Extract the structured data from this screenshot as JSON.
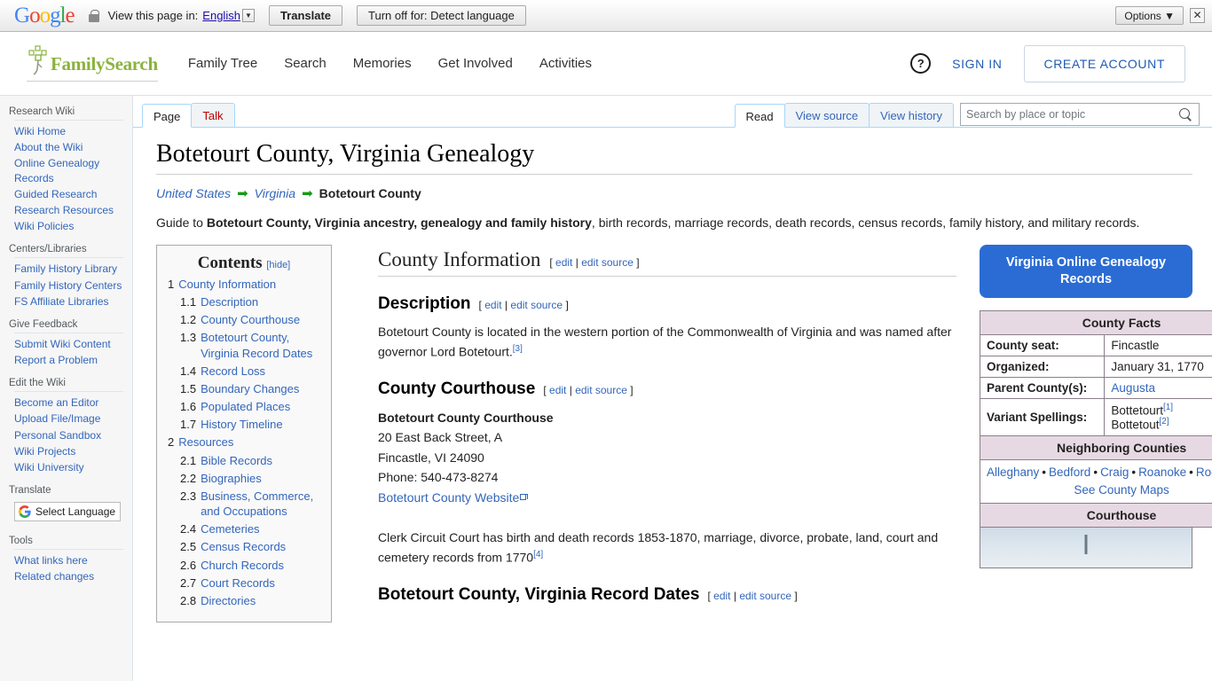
{
  "translate_bar": {
    "logo": "Google",
    "lock_icon": "lock-icon",
    "view_label": "View this page in:",
    "language": "English",
    "translate_button": "Translate",
    "turn_off_button": "Turn off for: Detect language",
    "options_button": "Options",
    "close_icon": "✕"
  },
  "header": {
    "brand": "FamilySearch",
    "nav": [
      {
        "label": "Family Tree"
      },
      {
        "label": "Search"
      },
      {
        "label": "Memories"
      },
      {
        "label": "Get Involved"
      },
      {
        "label": "Activities"
      }
    ],
    "help_icon": "?",
    "sign_in": "SIGN IN",
    "create_account": "CREATE ACCOUNT"
  },
  "sidebar": {
    "groups": [
      {
        "title": "Research Wiki",
        "items": [
          "Wiki Home",
          "About the Wiki",
          "Online Genealogy Records",
          "Guided Research",
          "Research Resources",
          "Wiki Policies"
        ]
      },
      {
        "title": "Centers/Libraries",
        "items": [
          "Family History Library",
          "Family History Centers",
          "FS Affiliate Libraries"
        ]
      },
      {
        "title": "Give Feedback",
        "items": [
          "Submit Wiki Content",
          "Report a Problem"
        ]
      },
      {
        "title": "Edit the Wiki",
        "items": [
          "Become an Editor",
          "Upload File/Image",
          "Personal Sandbox",
          "Wiki Projects",
          "Wiki University"
        ]
      }
    ],
    "translate_title": "Translate",
    "select_language": "Select Language",
    "tools_title": "Tools",
    "tools_items": [
      "What links here",
      "Related changes"
    ]
  },
  "tabs": {
    "left": [
      {
        "label": "Page",
        "state": "active"
      },
      {
        "label": "Talk",
        "state": "newpage"
      }
    ],
    "right": [
      {
        "label": "Read",
        "state": "active"
      },
      {
        "label": "View source",
        "state": "normal"
      },
      {
        "label": "View history",
        "state": "normal"
      }
    ],
    "search_placeholder": "Search by place or topic",
    "search_value": "",
    "search_icon": "search-icon"
  },
  "article": {
    "title": "Botetourt County, Virginia Genealogy",
    "breadcrumb": [
      {
        "label": "United States",
        "type": "link"
      },
      {
        "label": "Virginia",
        "type": "link"
      },
      {
        "label": "Botetourt County",
        "type": "current"
      }
    ],
    "intro_pre": "Guide to ",
    "intro_bold": "Botetourt County, Virginia ancestry, genealogy and family history",
    "intro_post": ", birth records, marriage records, death records, census records, family history, and military records.",
    "edit_open": "[",
    "edit_label": "edit",
    "edit_pipe": "|",
    "edit_source_label": "edit source",
    "edit_close": "]",
    "sections": {
      "county_information": "County Information",
      "description": "Description",
      "description_text": "Botetourt County is located in the western portion of the Commonwealth of Virginia and was named after governor Lord Botetourt.",
      "description_ref": "[3]",
      "county_courthouse": "County Courthouse",
      "courthouse_name": "Botetourt County Courthouse",
      "courthouse_street": "20 East Back Street, A",
      "courthouse_city": "Fincastle, VI 24090",
      "courthouse_phone": "Phone: 540-473-8274",
      "courthouse_website": "Botetourt County Website",
      "clerk_text": "Clerk Circuit Court has birth and death records 1853-1870, marriage, divorce, probate, land, court and cemetery records from 1770",
      "clerk_ref": "[4]",
      "record_dates": "Botetourt County, Virginia Record Dates"
    }
  },
  "toc": {
    "title": "Contents",
    "hide": "[hide]",
    "entries": [
      {
        "num": "1",
        "label": "County Information",
        "level": 1
      },
      {
        "num": "1.1",
        "label": "Description",
        "level": 2
      },
      {
        "num": "1.2",
        "label": "County Courthouse",
        "level": 2
      },
      {
        "num": "1.3",
        "label": "Botetourt County, Virginia Record Dates",
        "level": 2
      },
      {
        "num": "1.4",
        "label": "Record Loss",
        "level": 2
      },
      {
        "num": "1.5",
        "label": "Boundary Changes",
        "level": 2
      },
      {
        "num": "1.6",
        "label": "Populated Places",
        "level": 2
      },
      {
        "num": "1.7",
        "label": "History Timeline",
        "level": 2
      },
      {
        "num": "2",
        "label": "Resources",
        "level": 1
      },
      {
        "num": "2.1",
        "label": "Bible Records",
        "level": 2
      },
      {
        "num": "2.2",
        "label": "Biographies",
        "level": 2
      },
      {
        "num": "2.3",
        "label": "Business, Commerce, and Occupations",
        "level": 2
      },
      {
        "num": "2.4",
        "label": "Cemeteries",
        "level": 2
      },
      {
        "num": "2.5",
        "label": "Census Records",
        "level": 2
      },
      {
        "num": "2.6",
        "label": "Church Records",
        "level": 2
      },
      {
        "num": "2.7",
        "label": "Court Records",
        "level": 2
      },
      {
        "num": "2.8",
        "label": "Directories",
        "level": 2
      }
    ]
  },
  "infobox": {
    "online_records_button": "Virginia Online Genealogy Records",
    "facts_heading": "County Facts",
    "rows": [
      {
        "label": "County seat:",
        "value": "Fincastle",
        "link": false
      },
      {
        "label": "Organized:",
        "value": "January 31, 1770",
        "link": false
      },
      {
        "label": "Parent County(s):",
        "value": "Augusta",
        "link": true
      }
    ],
    "variant_label": "Variant Spellings:",
    "variants": [
      {
        "name": "Bottetourt",
        "ref": "[1]"
      },
      {
        "name": "Bottetout",
        "ref": "[2]"
      }
    ],
    "neighboring_heading": "Neighboring Counties",
    "neighbors": [
      "Alleghany",
      "Bedford",
      "Craig",
      "Roanoke",
      "Rockbridge"
    ],
    "see_county_maps": "See County Maps",
    "courthouse_heading": "Courthouse",
    "courthouse_photo_alt": "courthouse-photo"
  },
  "colors": {
    "fs_green": "#8ab33e",
    "link_blue": "#3366bb",
    "accent_blue": "#2b6cd4",
    "banner_mauve": "#e7d9e3"
  }
}
